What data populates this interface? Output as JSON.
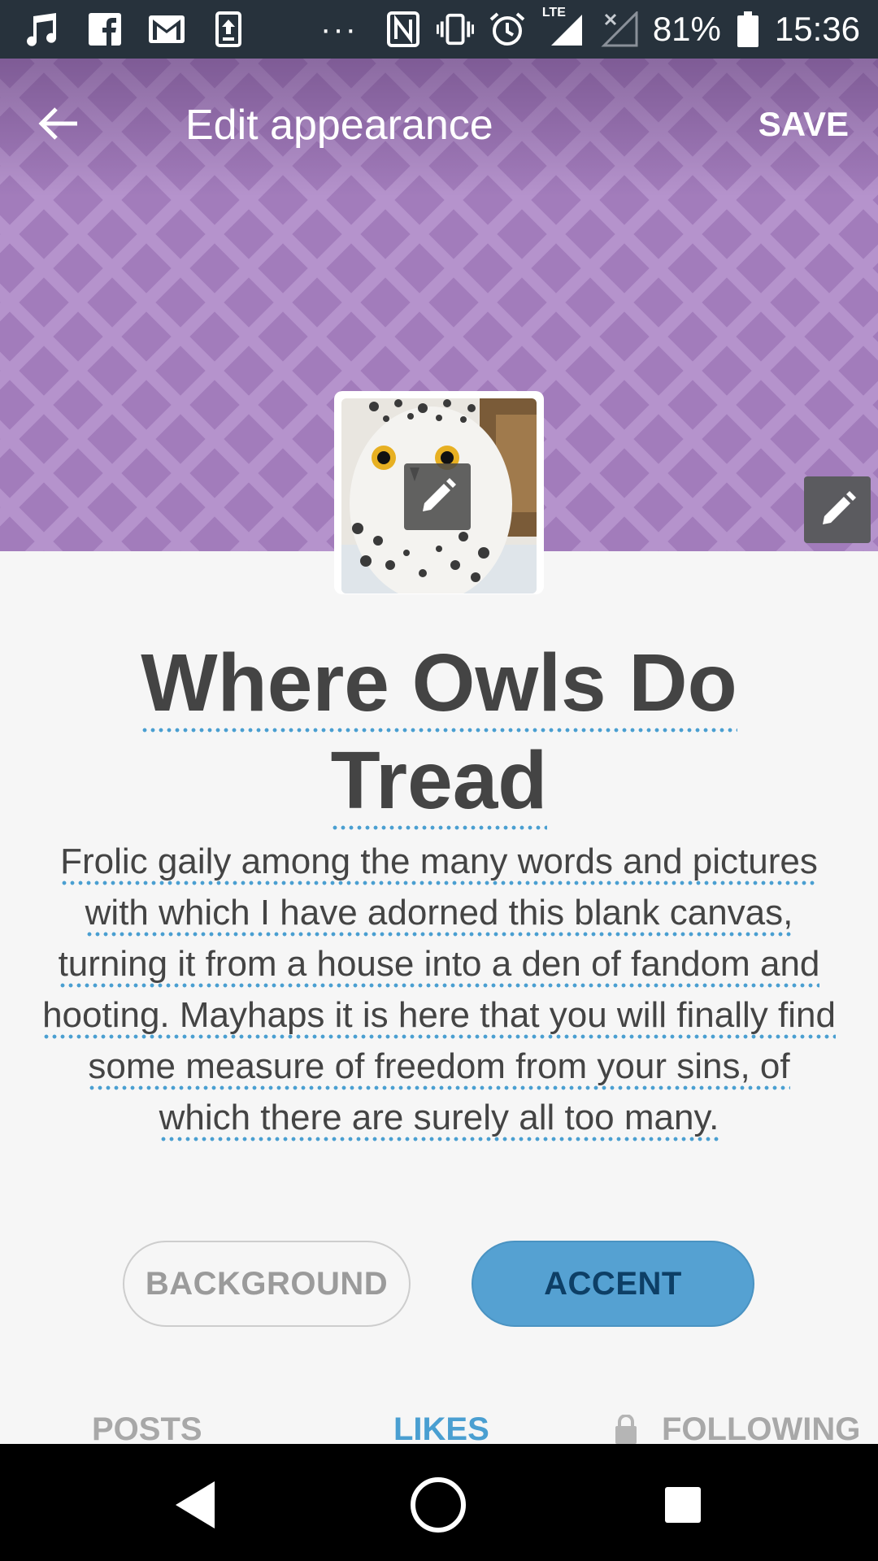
{
  "status_bar": {
    "battery": "81%",
    "time": "15:36",
    "network": "LTE",
    "icons": [
      "music-note-icon",
      "facebook-icon",
      "gmail-icon",
      "upload-icon",
      "more-dots-icon",
      "nfc-icon",
      "vibrate-icon",
      "alarm-icon",
      "signal-icon",
      "no-signal-icon",
      "battery-icon"
    ]
  },
  "header": {
    "title": "Edit appearance",
    "save_label": "SAVE",
    "back_icon": "arrow-left-icon",
    "edit_icon": "pencil-icon",
    "background_color": "#a07ab8"
  },
  "blog": {
    "title": "Where Owls Do Tread",
    "description": "Frolic gaily among the many words and pictures with which I have adorned this blank canvas, turning it from a house into a den of fandom and hooting. Mayhaps it is here that you will finally find some measure of freedom from your sins, of which there are surely all too many.",
    "avatar": "snowy-owl-avatar"
  },
  "buttons": {
    "background_label": "BACKGROUND",
    "accent_label": "ACCENT",
    "accent_color": "#55a1d2"
  },
  "tabs": [
    {
      "label": "POSTS",
      "active": false
    },
    {
      "label": "LIKES",
      "active": true
    },
    {
      "label": "FOLLOWING",
      "active": false,
      "locked": true
    }
  ],
  "nav": {
    "icons": [
      "back-triangle-icon",
      "home-circle-icon",
      "recents-square-icon"
    ]
  }
}
